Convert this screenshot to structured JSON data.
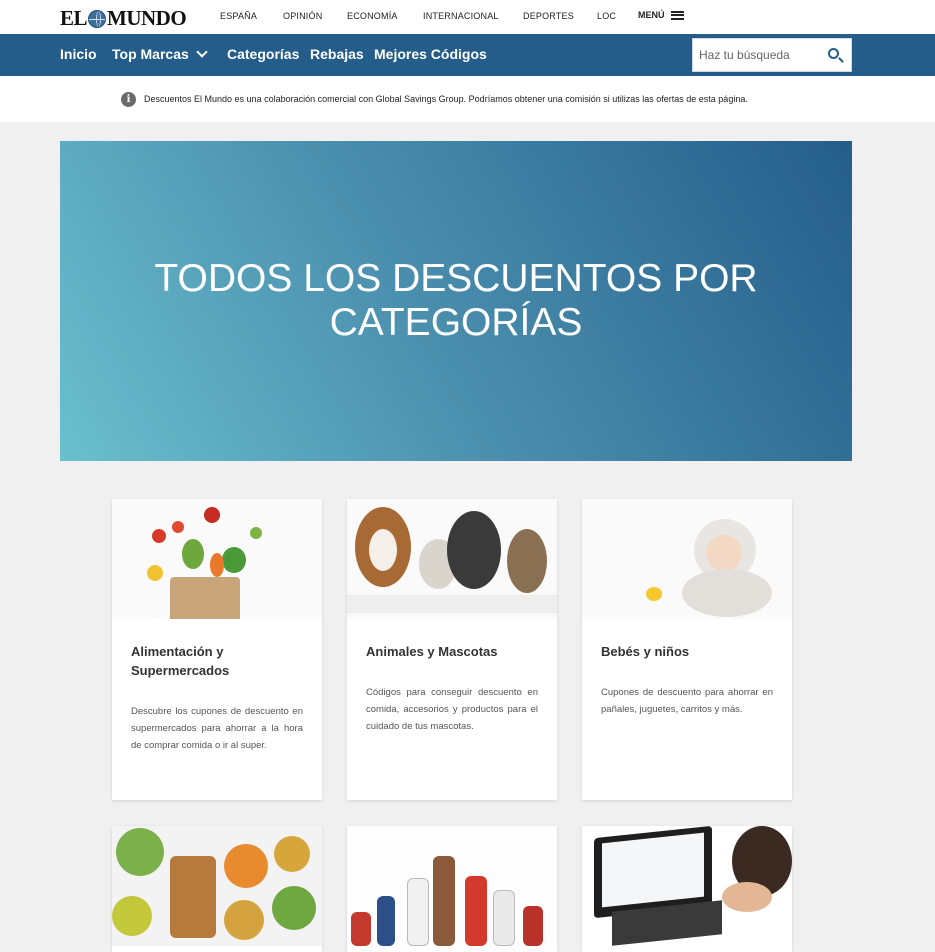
{
  "logo": {
    "left": "EL",
    "right": "MUNDO"
  },
  "topnav": [
    "ESPAÑA",
    "OPINIÓN",
    "ECONOMÍA",
    "INTERNACIONAL",
    "DEPORTES",
    "LOC"
  ],
  "menu_label": "MENÚ",
  "mainnav": {
    "items": [
      "Inicio",
      "Top Marcas",
      "Categorías",
      "Rebajas",
      "Mejores Códigos"
    ]
  },
  "search": {
    "placeholder": "Haz tu búsqueda"
  },
  "disclaimer": "Descuentos El Mundo es una colaboración comercial con Global Savings Group. Podríamos obtener una comisión si utilizas las ofertas de esta página.",
  "hero": {
    "title": "TODOS LOS DESCUENTOS POR CATEGORÍAS"
  },
  "categories": [
    {
      "title": "Alimentación y Supermercados",
      "description": "Descubre los cupones de descuento en supermercados para ahorrar a la hora de comprar comida o ir al super."
    },
    {
      "title": "Animales y Mascotas",
      "description": "Códigos para conseguir descuento en comida, accesorios y productos para el cuidado de tus mascotas."
    },
    {
      "title": "Bebés y niños",
      "description": "Cupones de descuento para ahorrar en pañales, juguetes, carritos y más."
    }
  ],
  "colors": {
    "nav": "#245d8a",
    "hero_start": "#6abfcd",
    "hero_end": "#245d8a",
    "background": "#f0f0f0"
  }
}
